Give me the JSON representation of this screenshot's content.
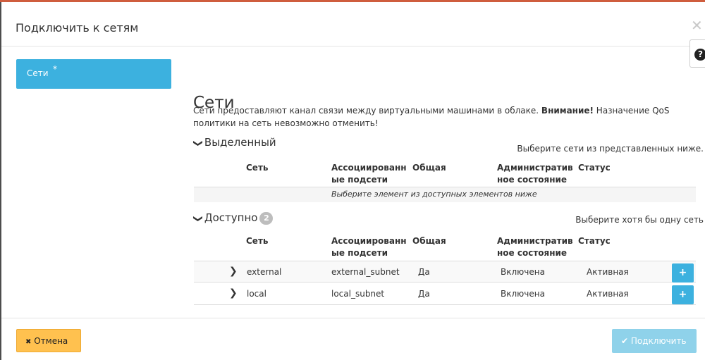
{
  "dialog": {
    "title": "Подключить к сетям",
    "close_glyph": "✕",
    "help_glyph": "?"
  },
  "tabs": [
    {
      "label": "Сети",
      "required_marker": "*",
      "active": true
    }
  ],
  "section": {
    "title": "Сети",
    "description_part1": "Сети предоставляют канал связи между виртуальными машинами в облаке. ",
    "description_strong": "Внимание!",
    "description_part2": " Назначение QoS политики на сеть невозможно отменить!"
  },
  "allocated": {
    "heading": "Выделенный",
    "hint": "Выберите сети из представленных ниже.",
    "columns": {
      "network": "Сеть",
      "subnets_1": "Ассоциированн",
      "subnets_2": "ые подсети",
      "shared": "Общая",
      "admin_1": "Административ",
      "admin_2": "ное состояние",
      "status": "Статус"
    },
    "empty_text": "Выберите элемент из доступных элементов ниже"
  },
  "available": {
    "heading": "Доступно",
    "count": "2",
    "hint": "Выберите хотя бы одну сеть",
    "columns": {
      "network": "Сеть",
      "subnets_1": "Ассоциированн",
      "subnets_2": "ые подсети",
      "shared": "Общая",
      "admin_1": "Административ",
      "admin_2": "ное состояние",
      "status": "Статус"
    },
    "rows": [
      {
        "name": "external",
        "subnets": "external_subnet",
        "shared": "Да",
        "admin_state": "Включена",
        "status": "Активная",
        "add": "+"
      },
      {
        "name": "local",
        "subnets": "local_subnet",
        "shared": "Да",
        "admin_state": "Включена",
        "status": "Активная",
        "add": "+"
      }
    ]
  },
  "footer": {
    "cancel_icon": "✖",
    "cancel_label": "Отмена",
    "connect_icon": "✔",
    "connect_label": "Подключить"
  },
  "colors": {
    "accent": "#3cb1df",
    "warning": "#ffc14f",
    "top_bar": "#cf5d3e"
  }
}
